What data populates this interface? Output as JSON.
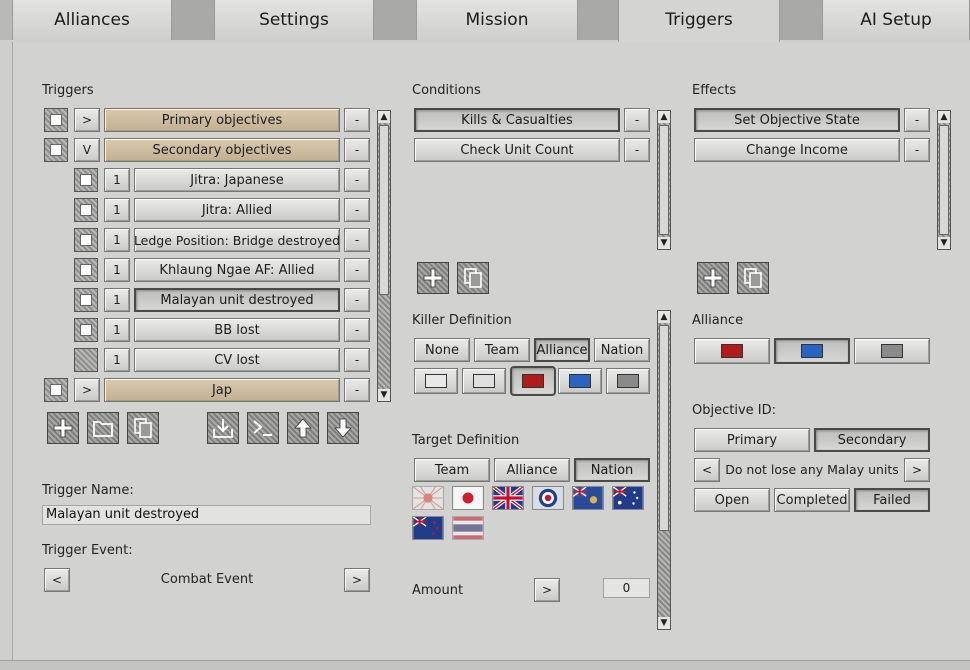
{
  "tabs": [
    {
      "label": "Alliances"
    },
    {
      "label": "Settings"
    },
    {
      "label": "Mission"
    },
    {
      "label": "Triggers"
    },
    {
      "label": "AI Setup"
    }
  ],
  "triggers": {
    "label": "Triggers",
    "rows": [
      {
        "toggle": ">",
        "label": "Primary objectives",
        "remove": "-"
      },
      {
        "toggle": "V",
        "label": "Secondary objectives",
        "remove": "-"
      },
      {
        "count": "1",
        "label": "Jitra: Japanese",
        "remove": "-"
      },
      {
        "count": "1",
        "label": "Jitra: Allied",
        "remove": "-"
      },
      {
        "count": "1",
        "label": "Ledge Position: Bridge destroyed",
        "remove": "-"
      },
      {
        "count": "1",
        "label": "Khlaung Ngae AF: Allied",
        "remove": "-"
      },
      {
        "count": "1",
        "label": "Malayan unit destroyed",
        "remove": "-"
      },
      {
        "count": "1",
        "label": "BB lost",
        "remove": "-"
      },
      {
        "count": "1",
        "label": "CV lost",
        "remove": "-"
      },
      {
        "toggle": ">",
        "label": "Jap",
        "remove": "-"
      }
    ]
  },
  "trigger_name": {
    "label": "Trigger Name:",
    "value": "Malayan unit destroyed"
  },
  "trigger_event": {
    "label": "Trigger Event:",
    "prev": "<",
    "value": "Combat Event",
    "next": ">"
  },
  "conditions": {
    "label": "Conditions",
    "items": [
      {
        "label": "Kills & Casualties",
        "remove": "-"
      },
      {
        "label": "Check Unit Count",
        "remove": "-"
      }
    ]
  },
  "killer_definition": {
    "label": "Killer Definition",
    "options": [
      "None",
      "Team",
      "Alliance",
      "Nation"
    ],
    "colors": [
      "#e8e8e8",
      "#e0e0e0",
      "#b01c1c",
      "#2a64c0",
      "#8a8a8a"
    ]
  },
  "target_definition": {
    "label": "Target Definition",
    "options": [
      "Team",
      "Alliance",
      "Nation"
    ]
  },
  "amount": {
    "label": "Amount",
    "button": ">",
    "value": "0"
  },
  "effects": {
    "label": "Effects",
    "items": [
      {
        "label": "Set Objective State",
        "remove": "-"
      },
      {
        "label": "Change Income",
        "remove": "-"
      }
    ]
  },
  "alliance": {
    "label": "Alliance",
    "colors": [
      "#b01c1c",
      "#2a64c0",
      "#8a8a8a"
    ]
  },
  "objective": {
    "label": "Objective ID:",
    "types": [
      "Primary",
      "Secondary"
    ],
    "prev": "<",
    "value": "Do not lose any Malay units",
    "next": ">",
    "states": [
      "Open",
      "Completed",
      "Failed"
    ]
  }
}
